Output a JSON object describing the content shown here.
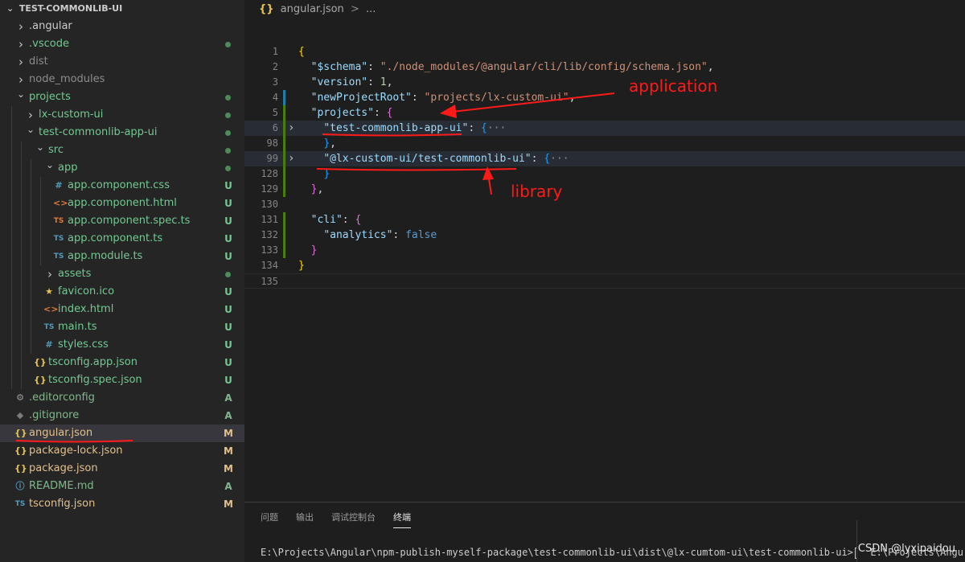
{
  "explorer": {
    "root_label": "TEST-COMMONLIB-UI",
    "items": [
      {
        "label": ".angular",
        "depth": 0,
        "kind": "folder",
        "expanded": false,
        "icon": "chevron-right-icon",
        "label_color": "#cccccc"
      },
      {
        "label": ".vscode",
        "depth": 0,
        "kind": "folder",
        "expanded": false,
        "icon": "chevron-right-icon",
        "label_color": "#73c991",
        "dot_color": "#4e8a5a"
      },
      {
        "label": "dist",
        "depth": 0,
        "kind": "folder",
        "expanded": false,
        "icon": "chevron-right-icon",
        "label_color": "#8c8c8c"
      },
      {
        "label": "node_modules",
        "depth": 0,
        "kind": "folder",
        "expanded": false,
        "icon": "chevron-right-icon",
        "label_color": "#8c8c8c"
      },
      {
        "label": "projects",
        "depth": 0,
        "kind": "folder",
        "expanded": true,
        "icon": "chevron-down-icon",
        "label_color": "#73c991",
        "dot_color": "#4e8a5a"
      },
      {
        "label": "lx-custom-ui",
        "depth": 1,
        "kind": "folder",
        "expanded": false,
        "icon": "chevron-right-icon",
        "label_color": "#73c991",
        "dot_color": "#4e8a5a"
      },
      {
        "label": "test-commonlib-app-ui",
        "depth": 1,
        "kind": "folder",
        "expanded": true,
        "icon": "chevron-down-icon",
        "label_color": "#73c991",
        "dot_color": "#4e8a5a"
      },
      {
        "label": "src",
        "depth": 2,
        "kind": "folder",
        "expanded": true,
        "icon": "chevron-down-icon",
        "label_color": "#73c991",
        "dot_color": "#4e8a5a"
      },
      {
        "label": "app",
        "depth": 3,
        "kind": "folder",
        "expanded": true,
        "icon": "chevron-down-icon",
        "label_color": "#73c991",
        "dot_color": "#4e8a5a"
      },
      {
        "label": "app.component.css",
        "depth": 4,
        "kind": "file",
        "glyph": "#",
        "glyph_color": "#519aba",
        "icon": "css-file-icon",
        "label_color": "#73c991",
        "badge": "U",
        "badge_color": "#73c991"
      },
      {
        "label": "app.component.html",
        "depth": 4,
        "kind": "file",
        "glyph": "<>",
        "glyph_color": "#e37933",
        "icon": "html-file-icon",
        "label_color": "#73c991",
        "badge": "U",
        "badge_color": "#73c991"
      },
      {
        "label": "app.component.spec.ts",
        "depth": 4,
        "kind": "file",
        "glyph": "TS",
        "glyph_color": "#e37933",
        "icon": "ts-spec-file-icon",
        "label_color": "#73c991",
        "badge": "U",
        "badge_color": "#73c991"
      },
      {
        "label": "app.component.ts",
        "depth": 4,
        "kind": "file",
        "glyph": "TS",
        "glyph_color": "#519aba",
        "icon": "ts-file-icon",
        "label_color": "#73c991",
        "badge": "U",
        "badge_color": "#73c991"
      },
      {
        "label": "app.module.ts",
        "depth": 4,
        "kind": "file",
        "glyph": "TS",
        "glyph_color": "#519aba",
        "icon": "ts-file-icon",
        "label_color": "#73c991",
        "badge": "U",
        "badge_color": "#73c991"
      },
      {
        "label": "assets",
        "depth": 3,
        "kind": "folder",
        "expanded": false,
        "icon": "chevron-right-icon",
        "label_color": "#73c991",
        "dot_color": "#4e8a5a"
      },
      {
        "label": "favicon.ico",
        "depth": 3,
        "kind": "file",
        "glyph": "★",
        "glyph_color": "#e8c44d",
        "icon": "star-file-icon",
        "label_color": "#73c991",
        "badge": "U",
        "badge_color": "#73c991"
      },
      {
        "label": "index.html",
        "depth": 3,
        "kind": "file",
        "glyph": "<>",
        "glyph_color": "#e37933",
        "icon": "html-file-icon",
        "label_color": "#73c991",
        "badge": "U",
        "badge_color": "#73c991"
      },
      {
        "label": "main.ts",
        "depth": 3,
        "kind": "file",
        "glyph": "TS",
        "glyph_color": "#519aba",
        "icon": "ts-file-icon",
        "label_color": "#73c991",
        "badge": "U",
        "badge_color": "#73c991"
      },
      {
        "label": "styles.css",
        "depth": 3,
        "kind": "file",
        "glyph": "#",
        "glyph_color": "#519aba",
        "icon": "css-file-icon",
        "label_color": "#73c991",
        "badge": "U",
        "badge_color": "#73c991"
      },
      {
        "label": "tsconfig.app.json",
        "depth": 2,
        "kind": "file",
        "glyph": "{}",
        "glyph_color": "#e8c44d",
        "icon": "json-file-icon",
        "label_color": "#73c991",
        "badge": "U",
        "badge_color": "#73c991"
      },
      {
        "label": "tsconfig.spec.json",
        "depth": 2,
        "kind": "file",
        "glyph": "{}",
        "glyph_color": "#e8c44d",
        "icon": "json-file-icon",
        "label_color": "#73c991",
        "badge": "U",
        "badge_color": "#73c991"
      },
      {
        "label": ".editorconfig",
        "depth": 0,
        "kind": "file",
        "glyph": "⚙",
        "glyph_color": "#9d9d9d",
        "icon": "gear-file-icon",
        "label_color": "#81b88b",
        "badge": "A",
        "badge_color": "#81b88b"
      },
      {
        "label": ".gitignore",
        "depth": 0,
        "kind": "file",
        "glyph": "◆",
        "glyph_color": "#7a7a7a",
        "icon": "git-file-icon",
        "label_color": "#81b88b",
        "badge": "A",
        "badge_color": "#81b88b"
      },
      {
        "label": "angular.json",
        "depth": 0,
        "kind": "file",
        "glyph": "{}",
        "glyph_color": "#e8c44d",
        "icon": "json-file-icon",
        "label_color": "#e2c08d",
        "badge": "M",
        "badge_color": "#e2c08d",
        "selected": true
      },
      {
        "label": "package-lock.json",
        "depth": 0,
        "kind": "file",
        "glyph": "{}",
        "glyph_color": "#e8c44d",
        "icon": "json-file-icon",
        "label_color": "#e2c08d",
        "badge": "M",
        "badge_color": "#e2c08d"
      },
      {
        "label": "package.json",
        "depth": 0,
        "kind": "file",
        "glyph": "{}",
        "glyph_color": "#e8c44d",
        "icon": "json-file-icon",
        "label_color": "#e2c08d",
        "badge": "M",
        "badge_color": "#e2c08d"
      },
      {
        "label": "README.md",
        "depth": 0,
        "kind": "file",
        "glyph": "ⓘ",
        "glyph_color": "#519aba",
        "icon": "info-file-icon",
        "label_color": "#81b88b",
        "badge": "A",
        "badge_color": "#81b88b"
      },
      {
        "label": "tsconfig.json",
        "depth": 0,
        "kind": "file",
        "glyph": "TS",
        "glyph_color": "#519aba",
        "icon": "ts-config-file-icon",
        "label_color": "#e2c08d",
        "badge": "M",
        "badge_color": "#e2c08d"
      }
    ]
  },
  "editor": {
    "breadcrumb": {
      "file": "angular.json",
      "separator": ">",
      "trail": "..."
    },
    "lines": [
      {
        "num": "1",
        "html": "<span class=\"br1\">{</span>"
      },
      {
        "num": "2",
        "html": "  <span class=\"k\">\"$schema\"</span>: <span class=\"s\">\"./node_modules/@angular/cli/lib/config/schema.json\"</span>,"
      },
      {
        "num": "3",
        "html": "  <span class=\"k\">\"version\"</span>: <span class=\"n\">1</span>,"
      },
      {
        "num": "4",
        "html": "  <span class=\"k\">\"newProjectRoot\"</span>: <span class=\"s\">\"projects/lx-custom-ui\"</span>,"
      },
      {
        "num": "5",
        "html": "  <span class=\"k\">\"projects\"</span>: <span class=\"br2\">{</span>"
      },
      {
        "num": "6",
        "html": "    <span class=\"k\">\"test-commonlib-app-ui\"</span>: <span class=\"br3\">{</span><span class=\"ell\">···</span>",
        "fold": true,
        "hl": true
      },
      {
        "num": "98",
        "html": "    <span class=\"br3\">}</span>,"
      },
      {
        "num": "99",
        "html": "    <span class=\"k\">\"@lx-custom-ui/test-commonlib-ui\"</span>: <span class=\"br3\">{</span><span class=\"ell\">···</span>",
        "fold": true,
        "hl": true
      },
      {
        "num": "128",
        "html": "    <span class=\"br3\">}</span>"
      },
      {
        "num": "129",
        "html": "  <span class=\"br2\">}</span>,"
      },
      {
        "num": "130",
        "html": ""
      },
      {
        "num": "131",
        "html": "  <span class=\"k\">\"cli\"</span>: <span class=\"br2\">{</span>"
      },
      {
        "num": "132",
        "html": "    <span class=\"k\">\"analytics\"</span>: <span class=\"kw\">false</span>"
      },
      {
        "num": "133",
        "html": "  <span class=\"br2\">}</span>"
      },
      {
        "num": "134",
        "html": "<span class=\"br1\">}</span>"
      },
      {
        "num": "135",
        "html": "",
        "cursor": true
      }
    ],
    "annotations": {
      "application": "application",
      "library": "library"
    }
  },
  "panel": {
    "tabs": [
      "问题",
      "输出",
      "调试控制台",
      "终端"
    ],
    "active_tab": "终端",
    "terminal_line": "E:\\Projects\\Angular\\npm-publish-myself-package\\test-commonlib-ui\\dist\\@lx-cumtom-ui\\test-commonlib-ui>",
    "terminal_right": "E:\\Projects\\Angu",
    "watermark": "CSDN @lyxipaidou"
  },
  "colors": {
    "annotation_red": "#ff1a1a",
    "untracked_green": "#73c991",
    "added_green": "#81b88b",
    "modified_yellow": "#e2c08d"
  }
}
